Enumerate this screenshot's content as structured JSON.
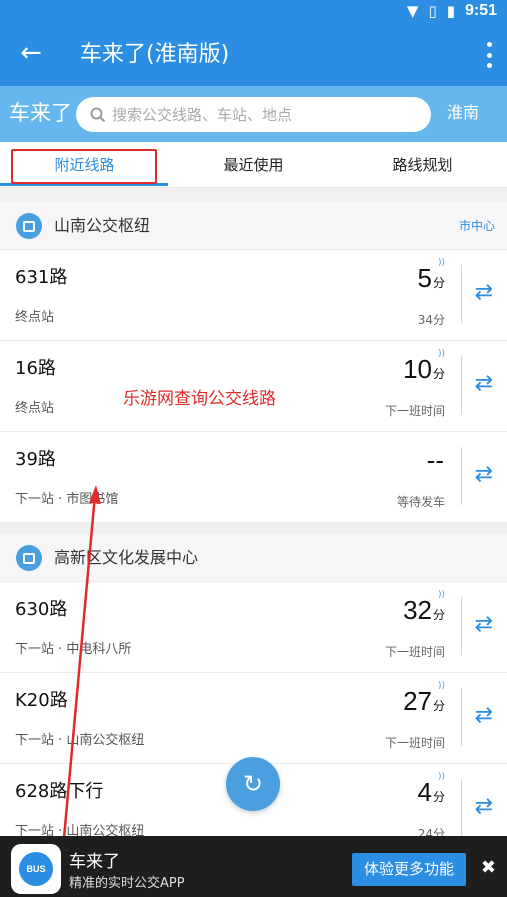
{
  "status_bar": {
    "time": "9:51"
  },
  "app_bar": {
    "title": "车来了(淮南版)"
  },
  "search": {
    "brand": "车来了",
    "placeholder": "搜索公交线路、车站、地点",
    "city": "淮南"
  },
  "tabs": [
    {
      "label": "附近线路",
      "active": true
    },
    {
      "label": "最近使用",
      "active": false
    },
    {
      "label": "路线规划",
      "active": false
    }
  ],
  "annotation": "乐游网查询公交线路",
  "stops": [
    {
      "name": "山南公交枢纽",
      "tag": "市中心",
      "routes": [
        {
          "name": "631路",
          "sub": "终点站",
          "eta": "5",
          "unit": "分",
          "status": "34分"
        },
        {
          "name": "16路",
          "sub": "终点站",
          "eta": "10",
          "unit": "分",
          "status": "下一班时间"
        },
        {
          "name": "39路",
          "sub": "下一站 · 市图书馆",
          "eta": "--",
          "unit": "",
          "status": "等待发车"
        }
      ]
    },
    {
      "name": "高新区文化发展中心",
      "tag": "",
      "routes": [
        {
          "name": "630路",
          "sub": "下一站 · 中电科八所",
          "eta": "32",
          "unit": "分",
          "status": "下一班时间"
        },
        {
          "name": "K20路",
          "sub": "下一站 · 山南公交枢纽",
          "eta": "27",
          "unit": "分",
          "status": "下一班时间"
        },
        {
          "name": "628路下行",
          "sub": "下一站 · 山南公交枢纽",
          "eta": "4",
          "unit": "分",
          "status": "24分"
        }
      ]
    }
  ],
  "banner": {
    "title": "车来了",
    "subtitle": "精准的实时公交APP",
    "cta": "体验更多功能",
    "logo_text": "BUS"
  },
  "colors": {
    "primary": "#2b8ee2",
    "search_bg": "#66b7ee",
    "annotation": "#e02b2b"
  }
}
